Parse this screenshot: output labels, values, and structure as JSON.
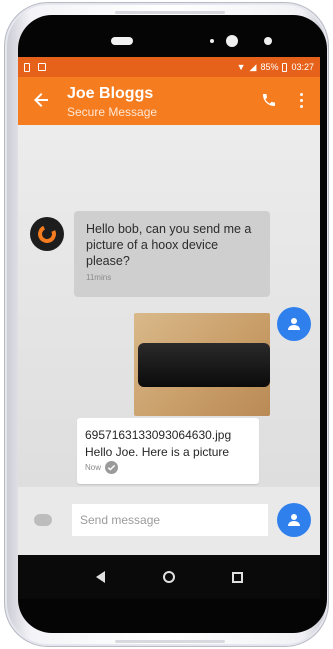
{
  "status_bar": {
    "battery": "85%",
    "time": "03:27"
  },
  "app_bar": {
    "title": "Joe Bloggs",
    "subtitle": "Secure Message"
  },
  "messages": [
    {
      "direction": "incoming",
      "text": "Hello bob, can you send me a picture of a hoox device please?",
      "time": "11mins"
    },
    {
      "direction": "outgoing",
      "filename": "6957163133093064630.jpg",
      "text": "Hello Joe. Here is a picture",
      "time": "Now"
    }
  ],
  "composer": {
    "placeholder": "Send message"
  },
  "colors": {
    "accent": "#f57c1f",
    "status_bar": "#e6621a",
    "user_avatar": "#2f80ed"
  },
  "icons": [
    "back-arrow-icon",
    "phone-icon",
    "more-vert-icon",
    "person-icon",
    "check-icon",
    "emoji-icon",
    "nav-back-icon",
    "nav-home-icon",
    "nav-recent-icon"
  ]
}
